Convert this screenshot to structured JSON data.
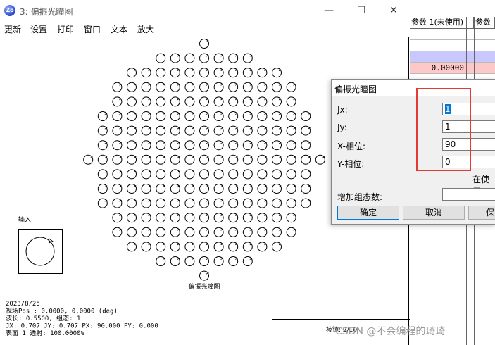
{
  "window": {
    "app_icon": "Zo",
    "title": "3: 偏振光瞳图",
    "minimize_icon": "—",
    "maximize_icon": "☐",
    "close_icon": "✕"
  },
  "menu": [
    "更新",
    "设置",
    "打印",
    "窗口",
    "文本",
    "放大"
  ],
  "plot": {
    "caption": "偏振光瞳图",
    "input_label": "输入:",
    "row_counts": [
      1,
      7,
      11,
      13,
      13,
      15,
      15,
      15,
      17,
      15,
      15,
      15,
      13,
      13,
      11,
      7,
      1
    ],
    "info_lines": [
      "2023/8/25",
      "视场Pos : 0.0000, 0.0000 (deg)",
      "波长: 0.5500, 组态: 1",
      "JX: 0.707 JY: 0.707 PX: 90.000 PY: 0.000",
      "表面 1 透射: 100.0000%"
    ],
    "footer_right": "棱镜: 2/10"
  },
  "sheet": {
    "col1": "参数 1(未使用)",
    "col2": "参数",
    "value": "0.00000",
    "row_colors": [
      "#ffffff",
      "#ffffff",
      "#c8c8ff",
      "#ffc8c8",
      "#ffffff"
    ]
  },
  "dialog": {
    "title": "偏振光瞳图",
    "fields": [
      {
        "label": "Jx:",
        "value": "1"
      },
      {
        "label": "Jy:",
        "value": "1"
      },
      {
        "label": "X-相位:",
        "value": "90"
      },
      {
        "label": "Y-相位:",
        "value": "0"
      }
    ],
    "in_use": "在使用",
    "config_label": "增加组态数:",
    "config_value": "",
    "ok": "确定",
    "cancel": "取消",
    "save": "保"
  },
  "watermark": "CSDN @不会编程的琦琦",
  "accent_color": "#e53935"
}
